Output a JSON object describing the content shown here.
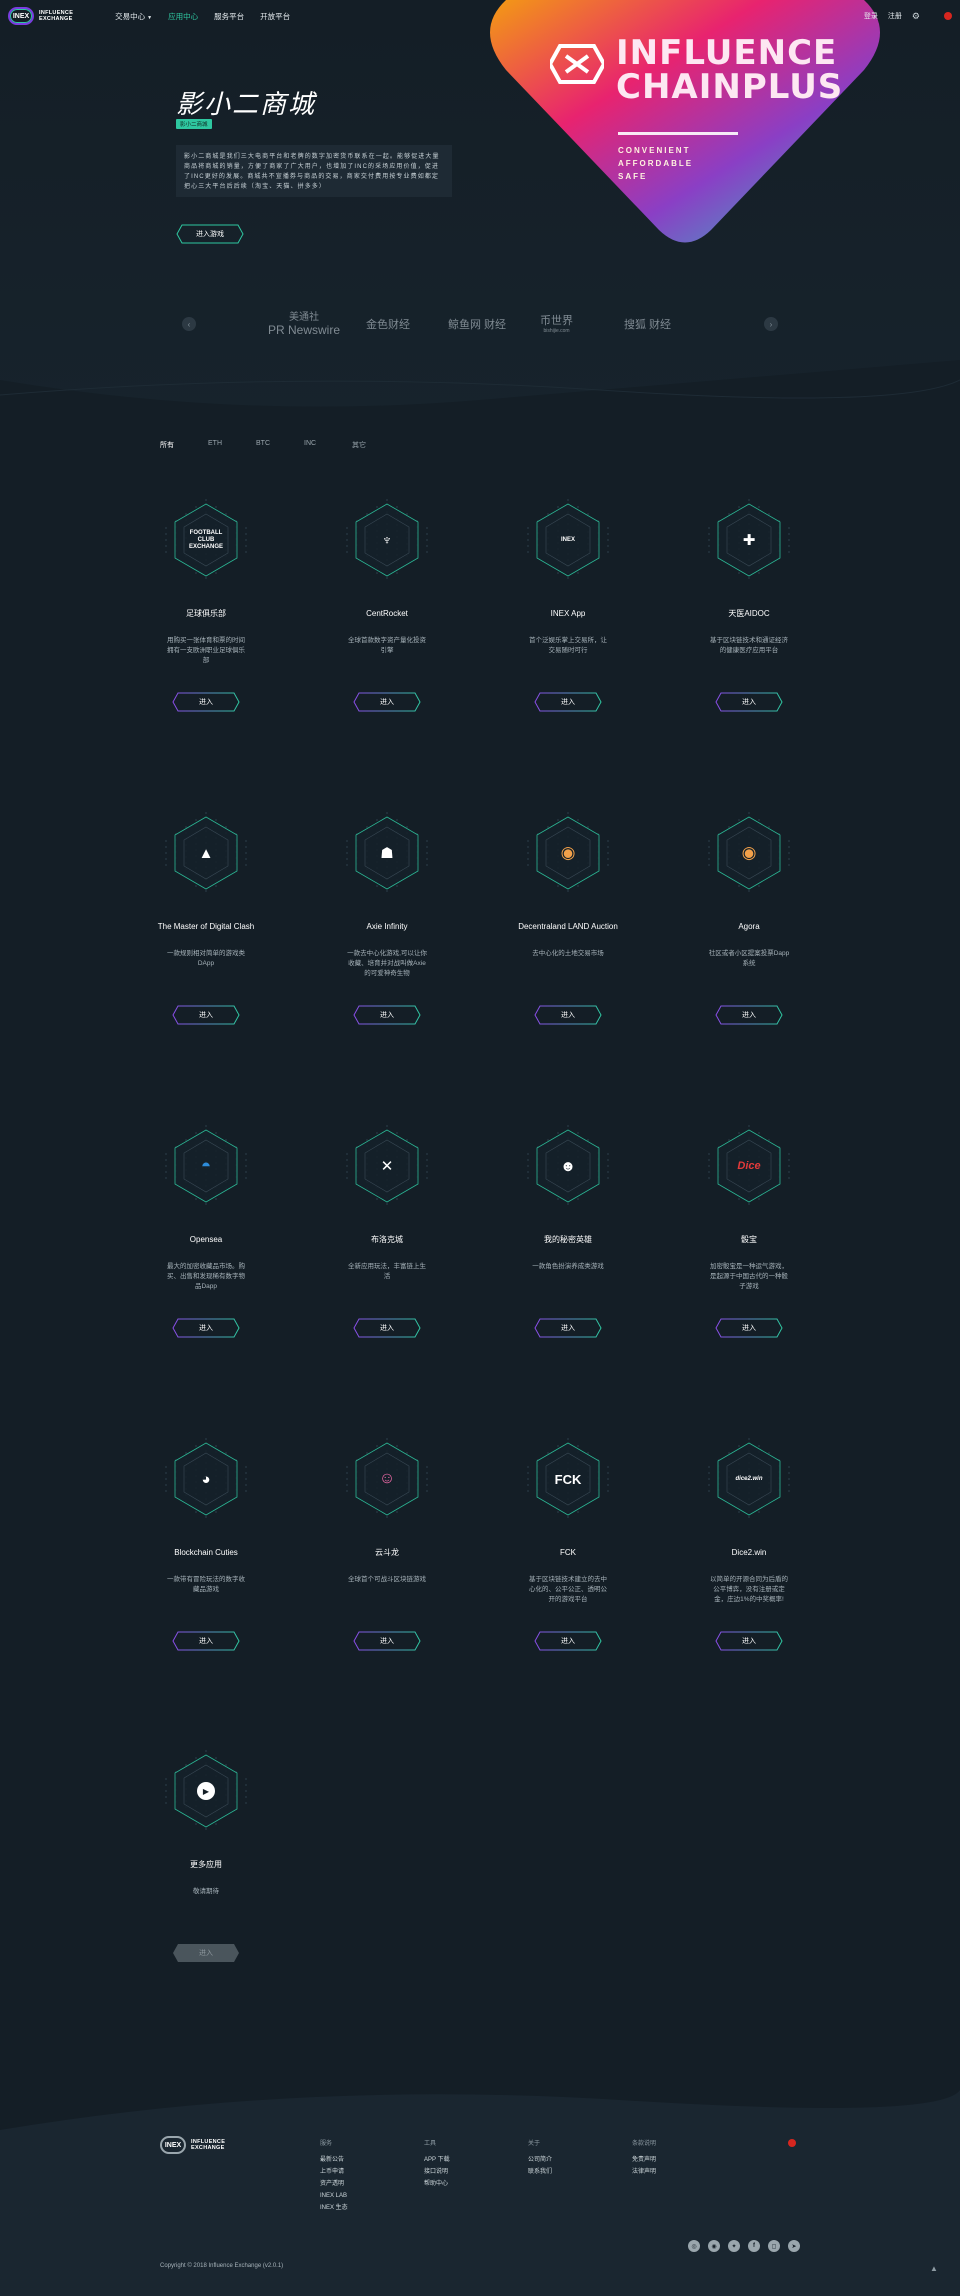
{
  "header": {
    "logo_mark": "INEX",
    "logo_line1": "INFLUENCE",
    "logo_line2": "EXCHANGE",
    "nav": [
      "交易中心",
      "应用中心",
      "服务平台",
      "开放平台"
    ],
    "active_nav": 1,
    "login": "登录",
    "register": "注册"
  },
  "hero": {
    "banner_line1": "INFLUENCE",
    "banner_line2": "CHAINPLUS",
    "banner_sub": [
      "CONVENIENT",
      "AFFORDABLE",
      "SAFE"
    ],
    "title": "影小二商城",
    "tag": "影小二商城",
    "description": "影小二商城是我们三大电商平台和老牌的数字加密货币联系在一起。能够促进大量商品将商城的销量，方便了商家了广大用户，也增加了INC的采场应用价值，促进了INC更好的发展。商城共不宣播券与商品的交易，商家交付费用按专业费如都定把心三大平台后后续（淘宝、天猫、拼多多）",
    "button": "进入游戏"
  },
  "partners": [
    {
      "name": "美通社",
      "sub": "PR Newswire"
    },
    {
      "name": "金色财经",
      "sub": ""
    },
    {
      "name": "鲸鱼网 财经",
      "sub": ""
    },
    {
      "name": "币世界",
      "sub": "bishijie.com"
    },
    {
      "name": "搜狐 财经",
      "sub": ""
    }
  ],
  "filters": [
    "所有",
    "ETH",
    "BTC",
    "INC",
    "其它"
  ],
  "active_filter": 0,
  "enter_label": "进入",
  "apps": [
    {
      "name": "足球俱乐部",
      "desc": "用购买一张体育和票的时间拥有一支欧洲职业足球俱乐部",
      "glyph": "FOOTBALL CLUB EXCHANGE",
      "kind": "text"
    },
    {
      "name": "CentRocket",
      "desc": "全球首款数字资产量化投资引擎",
      "glyph": "♆",
      "kind": "sym"
    },
    {
      "name": "INEX App",
      "desc": "首个泛娱乐掌上交易所，让交易随时可行",
      "glyph": "INEX",
      "kind": "hex"
    },
    {
      "name": "天医AIDOC",
      "desc": "基于区块链技术和通证经济的健康医疗应用平台",
      "glyph": "✚",
      "kind": "sym"
    },
    {
      "name": "The Master of Digital Clash",
      "desc": "一款规则相对简单的游戏类DApp",
      "glyph": "▲",
      "kind": "sym"
    },
    {
      "name": "Axie Infinity",
      "desc": "一款去中心化游戏,可以让你收藏、培育并对战叫做Axie的可爱神奇生物",
      "glyph": "☗",
      "kind": "sym"
    },
    {
      "name": "Decentraland LAND Auction",
      "desc": "去中心化的土地交易市场",
      "glyph": "◉",
      "kind": "orange"
    },
    {
      "name": "Agora",
      "desc": "社区或者小区提案投票Dapp系统",
      "glyph": "◉",
      "kind": "orange"
    },
    {
      "name": "Opensea",
      "desc": "最大的加密收藏品市场。购买、出售和发现稀有数字物品Dapp",
      "glyph": "◓",
      "kind": "blue"
    },
    {
      "name": "布洛克城",
      "desc": "全新应用玩法，丰富链上生活",
      "glyph": "✕",
      "kind": "sym"
    },
    {
      "name": "我的秘密英雄",
      "desc": "一款角色扮演养成类游戏",
      "glyph": "☻",
      "kind": "sym"
    },
    {
      "name": "骰宝",
      "desc": "加密骰宝是一种运气游戏，是起源于中国古代的一种骰子游戏",
      "glyph": "Dice",
      "kind": "dice"
    },
    {
      "name": "Blockchain Cuties",
      "desc": "一款带有冒险玩法的数字收藏品游戏",
      "glyph": "◕",
      "kind": "sym"
    },
    {
      "name": "云斗龙",
      "desc": "全球首个可战斗区块链游戏",
      "glyph": "☺",
      "kind": "pink"
    },
    {
      "name": "FCK",
      "desc": "基于区块链技术建立的去中心化的、公平公正、透明公开的游戏平台",
      "glyph": "FCK",
      "kind": "text2"
    },
    {
      "name": "Dice2.win",
      "desc": "以简单的开源合同为后盾的公平博弈，没有注册或定金，庄边1%的中奖概率!",
      "glyph": "dice2.win",
      "kind": "text3"
    },
    {
      "name": "更多应用",
      "desc": "敬请期待",
      "glyph": "▶",
      "kind": "play",
      "disabled": true
    }
  ],
  "footer": {
    "columns": [
      {
        "head": "服务",
        "items": [
          "最新公告",
          "上币申请",
          "资产透明",
          "INEX LAB",
          "INEX 生态"
        ]
      },
      {
        "head": "工具",
        "items": [
          "APP 下载",
          "接口说明",
          "帮助中心"
        ]
      },
      {
        "head": "关于",
        "items": [
          "公司简介",
          "联系我们"
        ]
      },
      {
        "head": "条款说明",
        "items": [
          "免责声明",
          "法律声明"
        ]
      }
    ],
    "socials": [
      "wechat-icon",
      "weibo-icon",
      "twitter-icon",
      "facebook-icon",
      "instagram-icon",
      "telegram-icon"
    ],
    "copyright": "Copyright © 2018 Influence Exchange (v2.0.1)"
  }
}
